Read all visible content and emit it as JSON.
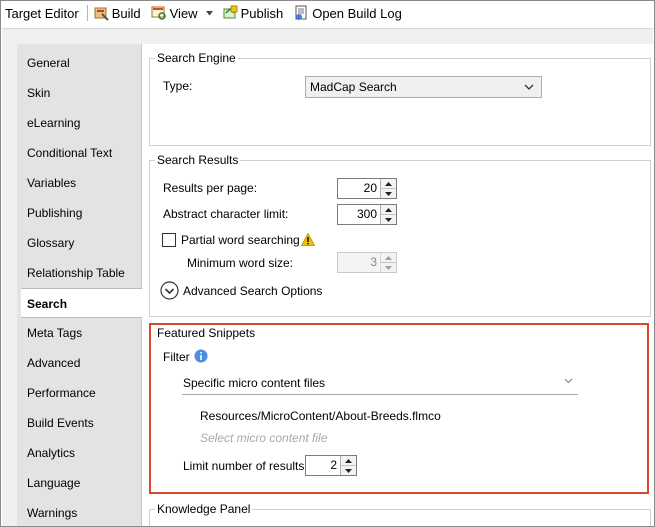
{
  "toolbar": {
    "title": "Target Editor",
    "build": "Build",
    "view": "View",
    "publish": "Publish",
    "open_build_log": "Open Build Log"
  },
  "nav": {
    "items": [
      "General",
      "Skin",
      "eLearning",
      "Conditional Text",
      "Variables",
      "Publishing",
      "Glossary",
      "Relationship Table",
      "Search",
      "Meta Tags",
      "Advanced",
      "Performance",
      "Build Events",
      "Analytics",
      "Language",
      "Warnings"
    ],
    "active": "Search"
  },
  "search_engine": {
    "legend": "Search Engine",
    "type_label": "Type:",
    "type_value": "MadCap Search"
  },
  "search_results": {
    "legend": "Search Results",
    "results_per_page_label": "Results per page:",
    "results_per_page": "20",
    "abstract_limit_label": "Abstract character limit:",
    "abstract_limit": "300",
    "partial_word_label": "Partial word searching",
    "min_word_size_label": "Minimum word size:",
    "min_word_size": "3",
    "advanced_label": "Advanced Search Options"
  },
  "featured_snippets": {
    "legend": "Featured Snippets",
    "filter_label": "Filter",
    "filter_value": "Specific micro content files",
    "file": "Resources/MicroContent/About-Breeds.flmco",
    "select_placeholder": "Select micro content file",
    "limit_label": "Limit number of results:",
    "limit_value": "2"
  },
  "knowledge_panel": {
    "legend": "Knowledge Panel"
  },
  "colors": {
    "highlight": "#d9482b",
    "info": "#4a90e2",
    "warning": "#f2c200"
  }
}
